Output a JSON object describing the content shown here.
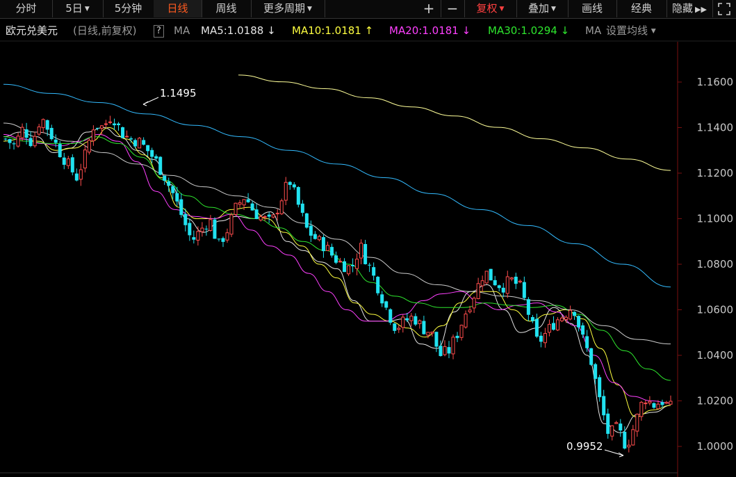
{
  "toolbar": {
    "tabs": [
      "分时",
      "5日",
      "5分钟",
      "日线",
      "周线",
      "更多周期"
    ],
    "active_tab": "日线",
    "zoom_in": "+",
    "zoom_out": "−",
    "adjust": "复权",
    "overlay": "叠加",
    "draw": "画线",
    "classic": "经典",
    "hide": "隐藏",
    "more_icon": "double-chevron-right",
    "fullscreen_icon": "expand-icon"
  },
  "legend": {
    "instrument": "欧元兑美元",
    "mode": "(日线,前复权)",
    "help": "?",
    "ma_label": "MA",
    "ma5": "MA5:1.0188",
    "ma5_arrow": "↓",
    "ma10": "MA10:1.0181",
    "ma10_arrow": "↑",
    "ma20": "MA20:1.0181",
    "ma20_arrow": "↓",
    "ma30": "MA30:1.0294",
    "ma30_arrow": "↓",
    "ma_more": "MA",
    "settings": "设置均线"
  },
  "colors": {
    "up": "#ff4d4d",
    "down": "#21e2f0",
    "ma5": "#e6e6e6",
    "ma10": "#ffff40",
    "ma20": "#ff40ff",
    "ma30": "#2ee62e",
    "ma60": "#cccccc",
    "ma120": "#33bbff",
    "ma250": "#ffff99"
  },
  "chart_data": {
    "type": "candlestick",
    "title": "欧元兑美元",
    "ylim": [
      0.9952,
      1.165
    ],
    "y_ticks": [
      "1.1600",
      "1.1400",
      "1.1200",
      "1.1000",
      "1.0800",
      "1.0600",
      "1.0400",
      "1.0200",
      "1.0000"
    ],
    "annotations": [
      {
        "text": "1.1495",
        "value": 1.1495,
        "kind": "high"
      },
      {
        "text": "0.9952",
        "value": 0.9952,
        "kind": "low"
      }
    ],
    "close_path": [
      1.135,
      1.132,
      1.14,
      1.133,
      1.145,
      1.138,
      1.13,
      1.124,
      1.118,
      1.128,
      1.142,
      1.14,
      1.146,
      1.138,
      1.135,
      1.134,
      1.13,
      1.125,
      1.118,
      1.11,
      1.1,
      1.09,
      1.095,
      1.1,
      1.088,
      1.095,
      1.105,
      1.11,
      1.103,
      1.1,
      1.098,
      1.108,
      1.117,
      1.106,
      1.095,
      1.091,
      1.088,
      1.083,
      1.08,
      1.078,
      1.088,
      1.079,
      1.07,
      1.06,
      1.052,
      1.055,
      1.057,
      1.052,
      1.05,
      1.04,
      1.042,
      1.05,
      1.06,
      1.068,
      1.077,
      1.073,
      1.07,
      1.073,
      1.07,
      1.058,
      1.045,
      1.05,
      1.055,
      1.058,
      1.062,
      1.048,
      1.038,
      1.02,
      1.005,
      1.008,
      1.0,
      1.01,
      1.022,
      1.018,
      1.02,
      1.017
    ],
    "ma_series": [
      {
        "name": "MA5",
        "values": [
          1.136,
          1.138,
          1.136,
          1.129,
          1.131,
          1.138,
          1.14,
          1.136,
          1.13,
          1.126,
          1.115,
          1.1,
          1.094,
          1.099,
          1.101,
          1.1,
          1.103,
          1.09,
          1.086,
          1.081,
          1.078,
          1.064,
          1.055,
          1.055,
          1.056,
          1.045,
          1.043,
          1.059,
          1.068,
          1.071,
          1.06,
          1.05,
          1.052,
          1.061,
          1.054,
          1.04,
          1.01,
          1.006,
          1.014,
          1.015,
          1.018
        ]
      },
      {
        "name": "MA10",
        "values": [
          1.134,
          1.135,
          1.134,
          1.13,
          1.131,
          1.134,
          1.14,
          1.135,
          1.128,
          1.118,
          1.105,
          1.1,
          1.1,
          1.104,
          1.105,
          1.1,
          1.094,
          1.088,
          1.08,
          1.074,
          1.063,
          1.058,
          1.055,
          1.052,
          1.048,
          1.053,
          1.063,
          1.068,
          1.068,
          1.06,
          1.055,
          1.058,
          1.06,
          1.056,
          1.043,
          1.027,
          1.013,
          1.016,
          1.018
        ]
      },
      {
        "name": "MA20",
        "values": [
          1.137,
          1.135,
          1.133,
          1.132,
          1.134,
          1.137,
          1.134,
          1.125,
          1.112,
          1.104,
          1.101,
          1.1,
          1.102,
          1.095,
          1.088,
          1.084,
          1.076,
          1.068,
          1.06,
          1.055,
          1.055,
          1.058,
          1.064,
          1.067,
          1.068,
          1.063,
          1.06,
          1.062,
          1.063,
          1.059,
          1.053,
          1.04,
          1.028,
          1.022,
          1.02,
          1.019
        ]
      },
      {
        "name": "MA30",
        "values": [
          1.136,
          1.134,
          1.133,
          1.133,
          1.136,
          1.133,
          1.127,
          1.117,
          1.11,
          1.105,
          1.102,
          1.1,
          1.096,
          1.09,
          1.086,
          1.08,
          1.072,
          1.066,
          1.063,
          1.061,
          1.061,
          1.063,
          1.062,
          1.061,
          1.062,
          1.058,
          1.051,
          1.042,
          1.034,
          1.029
        ]
      },
      {
        "name": "MA60",
        "values": [
          1.142,
          1.138,
          1.134,
          1.129,
          1.124,
          1.119,
          1.114,
          1.11,
          1.105,
          1.098,
          1.091,
          1.083,
          1.076,
          1.071,
          1.068,
          1.066,
          1.064,
          1.06,
          1.053,
          1.047,
          1.045
        ]
      },
      {
        "name": "MA120",
        "values": [
          1.159,
          1.155,
          1.151,
          1.146,
          1.141,
          1.136,
          1.13,
          1.124,
          1.118,
          1.111,
          1.104,
          1.097,
          1.089,
          1.08,
          1.07
        ]
      },
      {
        "name": "MA250",
        "values": [
          1.1631,
          1.1601,
          1.1571,
          1.1531,
          1.1491,
          1.1451,
          1.1401,
          1.1351,
          1.1311,
          1.1262,
          1.1212
        ]
      }
    ]
  }
}
